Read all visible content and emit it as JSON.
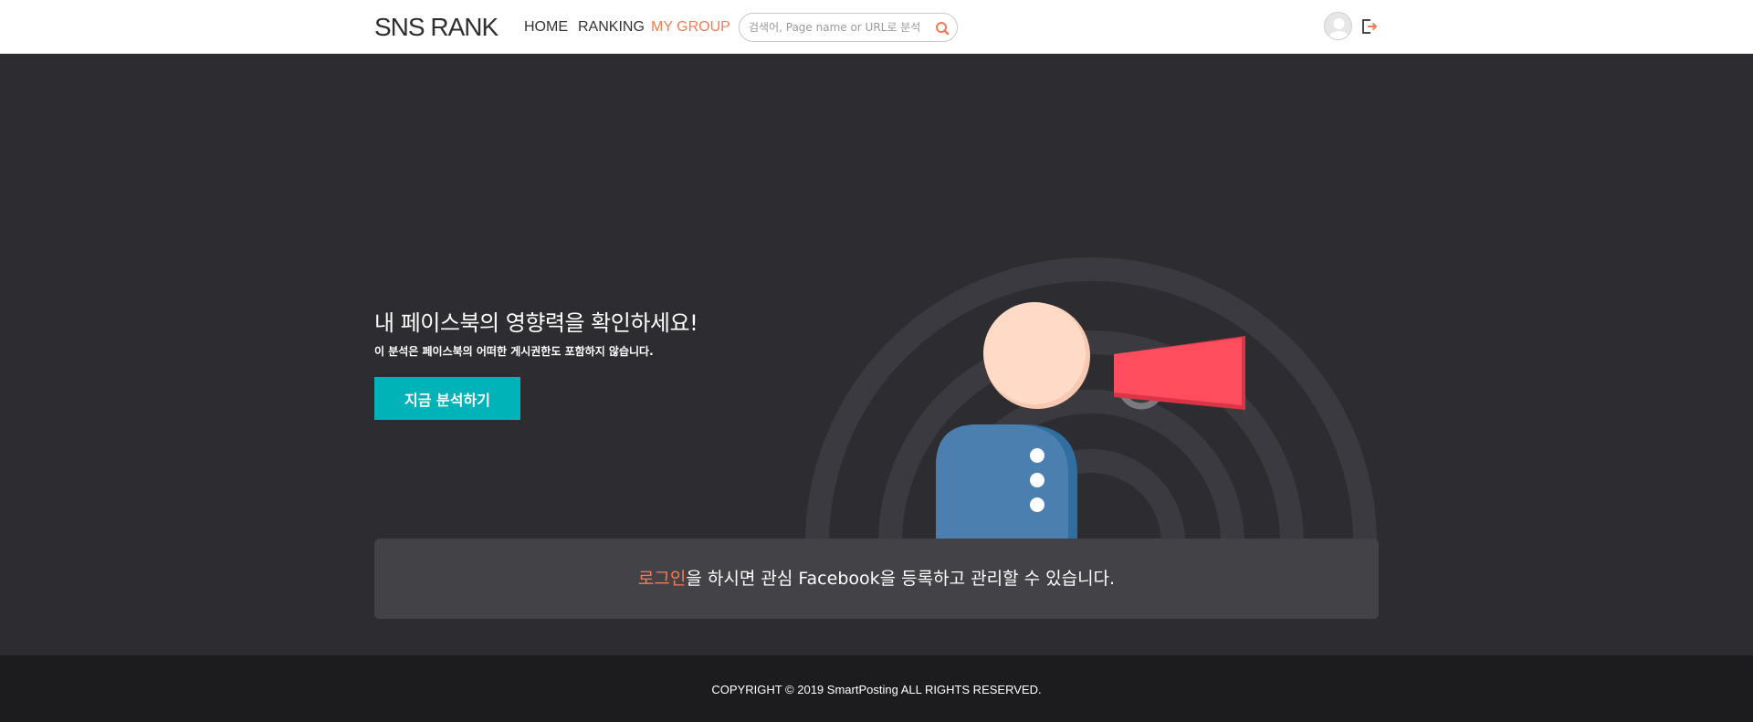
{
  "header": {
    "logo": "SNS RANK",
    "nav": {
      "home": "HOME",
      "ranking": "RANKING",
      "my_group": "MY GROUP"
    },
    "search": {
      "placeholder": "검색어, Page name or URL로 분석",
      "icon": "search-icon"
    },
    "avatar_icon": "user-avatar-icon",
    "logout_icon": "logout-icon"
  },
  "hero": {
    "title": "내 페이스북의 영향력을 확인하세요!",
    "subtitle": "이 분석은 페이스북의 어떠한 게시권한도 포함하지 않습니다.",
    "cta_label": "지금 분석하기",
    "illustration": "person-megaphone-illustration"
  },
  "notice": {
    "link_text": "로그인",
    "rest_text": "을 하시면 관심 Facebook을 등록하고 관리할 수 있습니다."
  },
  "footer": {
    "copyright": "COPYRIGHT © 2019 SmartPosting ALL RIGHTS RESERVED."
  },
  "colors": {
    "accent_orange": "#f47c55",
    "teal_button": "#00b3b8",
    "hero_bg": "#2c2c31",
    "notice_bg": "#424247",
    "footer_bg": "#1c1c1e",
    "megaphone_red": "#ff4d5e",
    "shirt_blue": "#4a7fb0",
    "face_peach": "#ffdac6"
  }
}
